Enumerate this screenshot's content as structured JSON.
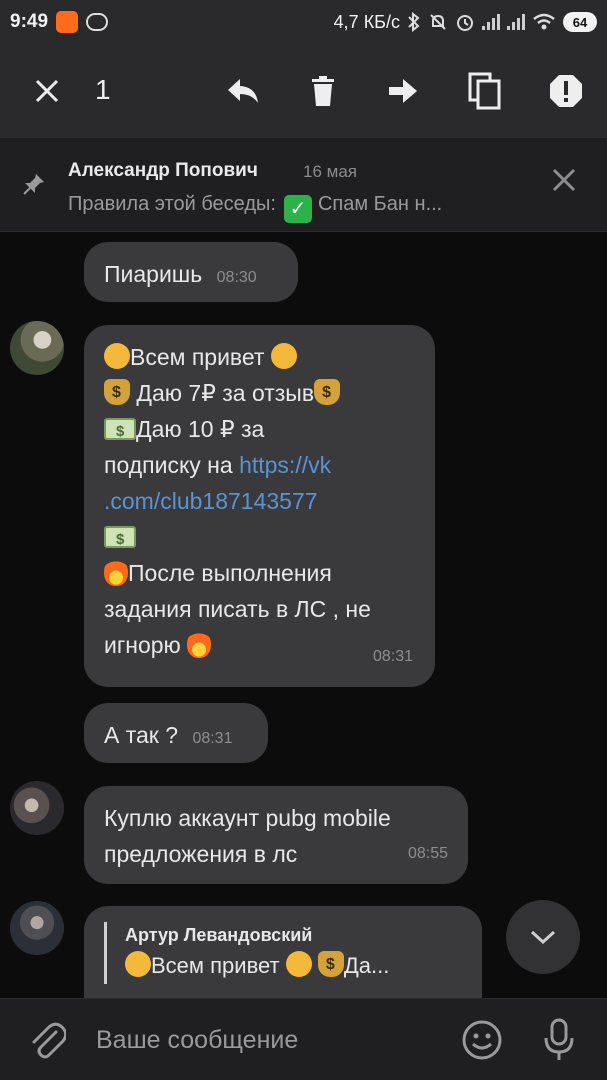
{
  "status_bar": {
    "time": "9:49",
    "network_speed": "4,7 КБ/с",
    "battery": "64"
  },
  "action_bar": {
    "selected_count": "1",
    "icons": [
      "close-icon",
      "reply-icon",
      "trash-icon",
      "forward-icon",
      "copy-icon",
      "report-icon"
    ]
  },
  "pinned": {
    "author": "Александр Попович",
    "date": "16 мая",
    "text": "Правила этой беседы:",
    "check": "✓",
    "tail": "Спам Бан н..."
  },
  "messages": [
    {
      "text": "Пиаришь",
      "time": "08:30"
    },
    {
      "lines": {
        "l1": "Всем привет",
        "l2": "Даю 7₽ за отзыв",
        "l3": "Даю 10 ₽ за",
        "l4a": "подписку на ",
        "link1": "https://vk",
        "link2": ".com/club187143577",
        "l6": "После выполнения",
        "l7": "задания писать в ЛС , не",
        "l8": "игнорю"
      },
      "time": "08:31"
    },
    {
      "text": "А так ?",
      "time": "08:31"
    },
    {
      "line1": "Куплю аккаунт pubg mobile",
      "line2": "предложения в лс",
      "time": "08:55"
    },
    {
      "reply_author": "Артур Левандовский",
      "reply_text_a": "Всем привет",
      "reply_text_b": "Да..."
    }
  ],
  "input": {
    "placeholder": "Ваше сообщение"
  },
  "colors": {
    "background": "#0c0c0c",
    "bubble": "#3a3a3c",
    "link": "#5a93d4",
    "header": "#2a2a2c"
  }
}
